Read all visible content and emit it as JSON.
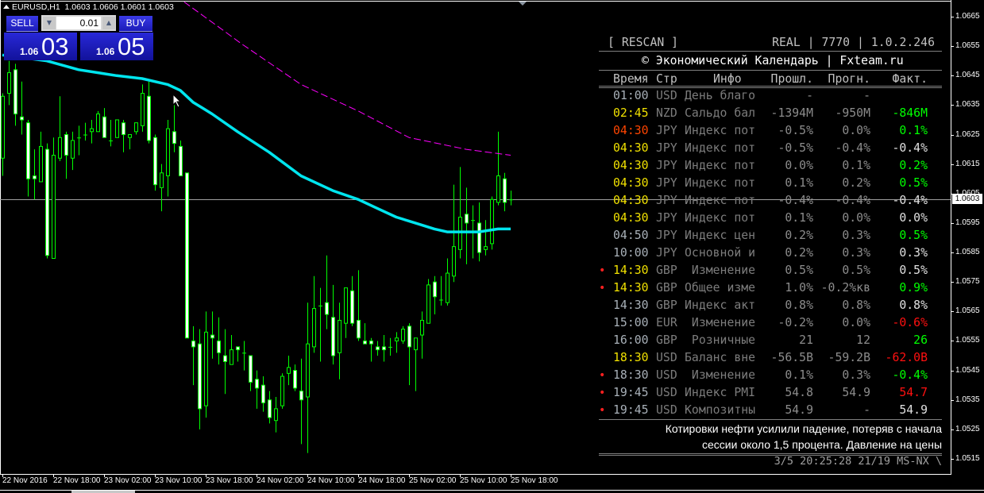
{
  "symbol_bar": {
    "symbol": "EURUSD,H1",
    "open": "1.0603",
    "high": "1.0606",
    "low": "1.0601",
    "close": "1.0603"
  },
  "trade_panel": {
    "sell_label": "SELL",
    "buy_label": "BUY",
    "lot": "0.01",
    "sell_price": {
      "prefix": "1.06",
      "big": "03"
    },
    "buy_price": {
      "prefix": "1.06",
      "big": "05"
    }
  },
  "price_axis": {
    "labels": [
      "1.0665",
      "1.0655",
      "1.0645",
      "1.0635",
      "1.0625",
      "1.0615",
      "1.0605",
      "1.0595",
      "1.0585",
      "1.0575",
      "1.0565",
      "1.0555",
      "1.0545",
      "1.0535",
      "1.0525",
      "1.0515"
    ],
    "current": "1.0603"
  },
  "time_axis": {
    "labels": [
      "22 Nov 2016",
      "22 Nov 18:00",
      "23 Nov 02:00",
      "23 Nov 10:00",
      "23 Nov 18:00",
      "24 Nov 02:00",
      "24 Nov 10:00",
      "24 Nov 18:00",
      "25 Nov 02:00",
      "25 Nov 10:00",
      "25 Nov 18:00"
    ]
  },
  "colors": {
    "bg": "#000000",
    "candle_outline": "#00ff00",
    "bear_body": "#ffffff",
    "bull_body": "#000000",
    "ma_fast": "#00e5ee",
    "ma_slow": "#ff00ff",
    "price_line": "#a0a0a0",
    "time_normal": "#a8b0b8",
    "time_soon": "#f0e000",
    "time_now": "#ff4500",
    "actual_up": "#00ff00",
    "actual_down": "#ff1010",
    "actual_same": "#e0e0e0"
  },
  "calendar": {
    "rescan": "[ RESCAN ]",
    "status": "REAL | 7770 | 1.0.2.246",
    "title": "© Экономический Календарь | Fxteam.ru",
    "columns": {
      "time": "Время",
      "country": "Стр",
      "info": "Инфо",
      "prev": "Прошл.",
      "forecast": "Прогн.",
      "actual": "Факт."
    },
    "rows": [
      {
        "dot": false,
        "time": "01:00",
        "time_color": "#a8b0b8",
        "country": "USD",
        "info": "День благо",
        "prev": "-",
        "forecast": "-",
        "actual": "",
        "actual_color": "#e0e0e0"
      },
      {
        "dot": false,
        "time": "02:45",
        "time_color": "#f0e000",
        "country": "NZD",
        "info": "Сальдо бал",
        "prev": "-1394M",
        "forecast": "-950M",
        "actual": "-846M",
        "actual_color": "#00ff00"
      },
      {
        "dot": false,
        "time": "04:30",
        "time_color": "#ff4500",
        "country": "JPY",
        "info": "Индекс пот",
        "prev": "-0.5%",
        "forecast": "0.0%",
        "actual": "0.1%",
        "actual_color": "#00ff00"
      },
      {
        "dot": false,
        "time": "04:30",
        "time_color": "#f0e000",
        "country": "JPY",
        "info": "Индекс пот",
        "prev": "-0.5%",
        "forecast": "-0.4%",
        "actual": "-0.4%",
        "actual_color": "#e0e0e0"
      },
      {
        "dot": false,
        "time": "04:30",
        "time_color": "#f0e000",
        "country": "JPY",
        "info": "Индекс пот",
        "prev": "0.0%",
        "forecast": "0.1%",
        "actual": "0.2%",
        "actual_color": "#00ff00"
      },
      {
        "dot": false,
        "time": "04:30",
        "time_color": "#f0e000",
        "country": "JPY",
        "info": "Индекс пот",
        "prev": "0.1%",
        "forecast": "0.2%",
        "actual": "0.5%",
        "actual_color": "#00ff00"
      },
      {
        "dot": false,
        "time": "04:30",
        "time_color": "#f0e000",
        "country": "JPY",
        "info": "Индекс пот",
        "prev": "-0.4%",
        "forecast": "-0.4%",
        "actual": "-0.4%",
        "actual_color": "#e0e0e0"
      },
      {
        "dot": false,
        "time": "04:30",
        "time_color": "#f0e000",
        "country": "JPY",
        "info": "Индекс пот",
        "prev": "0.1%",
        "forecast": "0.0%",
        "actual": "0.0%",
        "actual_color": "#e0e0e0"
      },
      {
        "dot": false,
        "time": "04:50",
        "time_color": "#a8b0b8",
        "country": "JPY",
        "info": "Индекс цен",
        "prev": "0.2%",
        "forecast": "0.3%",
        "actual": "0.5%",
        "actual_color": "#00ff00"
      },
      {
        "dot": false,
        "time": "10:00",
        "time_color": "#a8b0b8",
        "country": "JPY",
        "info": "Основной и",
        "prev": "0.2%",
        "forecast": "0.3%",
        "actual": "0.3%",
        "actual_color": "#e0e0e0"
      },
      {
        "dot": true,
        "time": "14:30",
        "time_color": "#f0e000",
        "country": "GBP",
        "info": " Изменение",
        "prev": "0.5%",
        "forecast": "0.5%",
        "actual": "0.5%",
        "actual_color": "#e0e0e0"
      },
      {
        "dot": true,
        "time": "14:30",
        "time_color": "#f0e000",
        "country": "GBP",
        "info": "Общее изме",
        "prev": "1.0%",
        "forecast": "-0.2%кв",
        "actual": "0.9%",
        "actual_color": "#00ff00"
      },
      {
        "dot": false,
        "time": "14:30",
        "time_color": "#a8b0b8",
        "country": "GBP",
        "info": "Индекс акт",
        "prev": "0.8%",
        "forecast": "0.8%",
        "actual": "0.8%",
        "actual_color": "#e0e0e0"
      },
      {
        "dot": false,
        "time": "15:00",
        "time_color": "#a8b0b8",
        "country": "EUR",
        "info": " Изменение",
        "prev": "-0.2%",
        "forecast": "0.0%",
        "actual": "-0.6%",
        "actual_color": "#ff1010"
      },
      {
        "dot": false,
        "time": "16:00",
        "time_color": "#a8b0b8",
        "country": "GBP",
        "info": " Розничные",
        "prev": "21",
        "forecast": "12",
        "actual": "26",
        "actual_color": "#00ff00"
      },
      {
        "dot": false,
        "time": "18:30",
        "time_color": "#f0e000",
        "country": "USD",
        "info": "Баланс вне",
        "prev": "-56.5B",
        "forecast": "-59.2B",
        "actual": "-62.0B",
        "actual_color": "#ff1010"
      },
      {
        "dot": true,
        "time": "18:30",
        "time_color": "#a8b0b8",
        "country": "USD",
        "info": " Изменение",
        "prev": "0.1%",
        "forecast": "0.3%",
        "actual": "-0.4%",
        "actual_color": "#00ff00"
      },
      {
        "dot": true,
        "time": "19:45",
        "time_color": "#a8b0b8",
        "country": "USD",
        "info": "Индекс PMI",
        "prev": "54.8",
        "forecast": "54.9",
        "actual": "54.7",
        "actual_color": "#ff1010"
      },
      {
        "dot": true,
        "time": "19:45",
        "time_color": "#a8b0b8",
        "country": "USD",
        "info": "Композитны",
        "prev": "54.9",
        "forecast": "-",
        "actual": "54.9",
        "actual_color": "#e0e0e0"
      }
    ],
    "news": [
      "Котировки нефти усилили падение, потеряв с начала",
      "сессии около 1,5 процента. Давление на цены"
    ],
    "footer": "3/5 20:25:28 21/19 MS-NX \\"
  },
  "chart_data": {
    "type": "candlestick",
    "symbol": "EURUSD",
    "timeframe": "H1",
    "ylim": [
      1.0508,
      1.0671
    ],
    "current_price": 1.0603,
    "ohlc": [
      [
        1.0617,
        1.0639,
        1.0611,
        1.0638
      ],
      [
        1.0639,
        1.065,
        1.0635,
        1.0646
      ],
      [
        1.0647,
        1.0649,
        1.0628,
        1.0632
      ],
      [
        1.0631,
        1.0643,
        1.0625,
        1.063
      ],
      [
        1.0629,
        1.063,
        1.0604,
        1.061
      ],
      [
        1.0611,
        1.062,
        1.0603,
        1.061
      ],
      [
        1.0609,
        1.0626,
        1.0609,
        1.0621
      ],
      [
        1.062,
        1.0622,
        1.0583,
        1.0584
      ],
      [
        1.0583,
        1.0624,
        1.0583,
        1.0618
      ],
      [
        1.0617,
        1.0638,
        1.0616,
        1.0624
      ],
      [
        1.0625,
        1.0626,
        1.061,
        1.0618
      ],
      [
        1.0617,
        1.0626,
        1.0613,
        1.0623
      ],
      [
        1.0624,
        1.0628,
        1.0618,
        1.0624
      ],
      [
        1.0625,
        1.0629,
        1.0623,
        1.0625
      ],
      [
        1.0626,
        1.063,
        1.0622,
        1.0627
      ],
      [
        1.0626,
        1.0633,
        1.0626,
        1.0632
      ],
      [
        1.0631,
        1.0634,
        1.0624,
        1.0624
      ],
      [
        1.0623,
        1.063,
        1.0621,
        1.0623
      ],
      [
        1.0624,
        1.063,
        1.0624,
        1.063
      ],
      [
        1.0629,
        1.063,
        1.0619,
        1.0625
      ],
      [
        1.0624,
        1.0625,
        1.062,
        1.0625
      ],
      [
        1.0626,
        1.0629,
        1.0625,
        1.0629
      ],
      [
        1.0628,
        1.0642,
        1.0626,
        1.0639
      ],
      [
        1.0638,
        1.0643,
        1.0622,
        1.0623
      ],
      [
        1.0624,
        1.0625,
        1.0606,
        1.0608
      ],
      [
        1.0607,
        1.0615,
        1.0599,
        1.0612
      ],
      [
        1.0611,
        1.063,
        1.0604,
        1.0627
      ],
      [
        1.0626,
        1.0635,
        1.0619,
        1.0622
      ],
      [
        1.0621,
        1.0623,
        1.0611,
        1.0611
      ],
      [
        1.0612,
        1.0612,
        1.0556,
        1.0556
      ],
      [
        1.0555,
        1.056,
        1.054,
        1.0553
      ],
      [
        1.0554,
        1.0559,
        1.0525,
        1.0532
      ],
      [
        1.0533,
        1.0565,
        1.0529,
        1.0558
      ],
      [
        1.0557,
        1.0565,
        1.0549,
        1.0556
      ],
      [
        1.0555,
        1.0563,
        1.0547,
        1.0551
      ],
      [
        1.055,
        1.0559,
        1.0537,
        1.0548
      ],
      [
        1.0547,
        1.0557,
        1.0547,
        1.0552
      ],
      [
        1.0553,
        1.0553,
        1.0548,
        1.0552
      ],
      [
        1.0551,
        1.0555,
        1.0545,
        1.0551
      ],
      [
        1.055,
        1.055,
        1.0538,
        1.0541
      ],
      [
        1.0542,
        1.0545,
        1.0532,
        1.0539
      ],
      [
        1.054,
        1.0543,
        1.0531,
        1.0534
      ],
      [
        1.0535,
        1.0538,
        1.0527,
        1.0529
      ],
      [
        1.0528,
        1.0536,
        1.0524,
        1.0532
      ],
      [
        1.0533,
        1.0544,
        1.0532,
        1.0543
      ],
      [
        1.0544,
        1.055,
        1.054,
        1.0546
      ],
      [
        1.0545,
        1.0547,
        1.0538,
        1.0539
      ],
      [
        1.0538,
        1.0549,
        1.052,
        1.0535
      ],
      [
        1.0536,
        1.0568,
        1.0517,
        1.0554
      ],
      [
        1.0553,
        1.0577,
        1.0551,
        1.0566
      ],
      [
        1.0567,
        1.0573,
        1.0548,
        1.0567
      ],
      [
        1.0568,
        1.0584,
        1.0559,
        1.0564
      ],
      [
        1.0563,
        1.0574,
        1.0547,
        1.055
      ],
      [
        1.0551,
        1.0568,
        1.0542,
        1.0562
      ],
      [
        1.0561,
        1.0573,
        1.0556,
        1.0573
      ],
      [
        1.0572,
        1.0577,
        1.056,
        1.0561
      ],
      [
        1.0562,
        1.0579,
        1.0555,
        1.0556
      ],
      [
        1.0555,
        1.0561,
        1.0554,
        1.0554
      ],
      [
        1.0555,
        1.0556,
        1.0548,
        1.0554
      ],
      [
        1.0553,
        1.0555,
        1.055,
        1.0552
      ],
      [
        1.0553,
        1.0557,
        1.0548,
        1.0552
      ],
      [
        1.0553,
        1.0556,
        1.055,
        1.0553
      ],
      [
        1.0555,
        1.0558,
        1.0551,
        1.0556
      ],
      [
        1.0555,
        1.056,
        1.0554,
        1.0559
      ],
      [
        1.056,
        1.0561,
        1.054,
        1.0553
      ],
      [
        1.0552,
        1.0556,
        1.0538,
        1.0556
      ],
      [
        1.0557,
        1.0565,
        1.0549,
        1.0562
      ],
      [
        1.0561,
        1.0576,
        1.0561,
        1.0574
      ],
      [
        1.0575,
        1.0577,
        1.0564,
        1.057
      ],
      [
        1.0569,
        1.0577,
        1.0567,
        1.0569
      ],
      [
        1.0568,
        1.0583,
        1.0567,
        1.0578
      ],
      [
        1.0577,
        1.0608,
        1.0575,
        1.0587
      ],
      [
        1.0586,
        1.0614,
        1.0583,
        1.0597
      ],
      [
        1.0598,
        1.0607,
        1.0581,
        1.0595
      ],
      [
        1.0596,
        1.0601,
        1.0583,
        1.0596
      ],
      [
        1.0595,
        1.0602,
        1.0582,
        1.0585
      ],
      [
        1.0586,
        1.0596,
        1.0584,
        1.0587
      ],
      [
        1.0588,
        1.0604,
        1.0586,
        1.0603
      ],
      [
        1.0602,
        1.0626,
        1.0601,
        1.0611
      ],
      [
        1.061,
        1.0612,
        1.0599,
        1.0602
      ],
      [
        1.0603,
        1.0606,
        1.0601,
        1.0603
      ]
    ],
    "ma_fast": [
      [
        0,
        1.0652
      ],
      [
        7,
        1.065
      ],
      [
        12,
        1.0647
      ],
      [
        18,
        1.0645
      ],
      [
        22,
        1.0644
      ],
      [
        26,
        1.0642
      ],
      [
        28,
        1.064
      ],
      [
        30,
        1.0636
      ],
      [
        33,
        1.0632
      ],
      [
        37,
        1.0626
      ],
      [
        42,
        1.0619
      ],
      [
        47,
        1.0611
      ],
      [
        52,
        1.0606
      ],
      [
        56,
        1.0603
      ],
      [
        59,
        1.06
      ],
      [
        62,
        1.0597
      ],
      [
        65,
        1.0595
      ],
      [
        68,
        1.0593
      ],
      [
        70,
        1.0592
      ],
      [
        75,
        1.0592
      ],
      [
        78,
        1.0593
      ],
      [
        80,
        1.0593
      ]
    ],
    "ma_slow": [
      [
        28.6,
        1.067
      ],
      [
        35,
        1.066
      ],
      [
        37.5,
        1.0656
      ],
      [
        47,
        1.0642
      ],
      [
        56,
        1.0633
      ],
      [
        64,
        1.0624
      ],
      [
        73,
        1.062
      ],
      [
        80,
        1.0618
      ]
    ]
  }
}
